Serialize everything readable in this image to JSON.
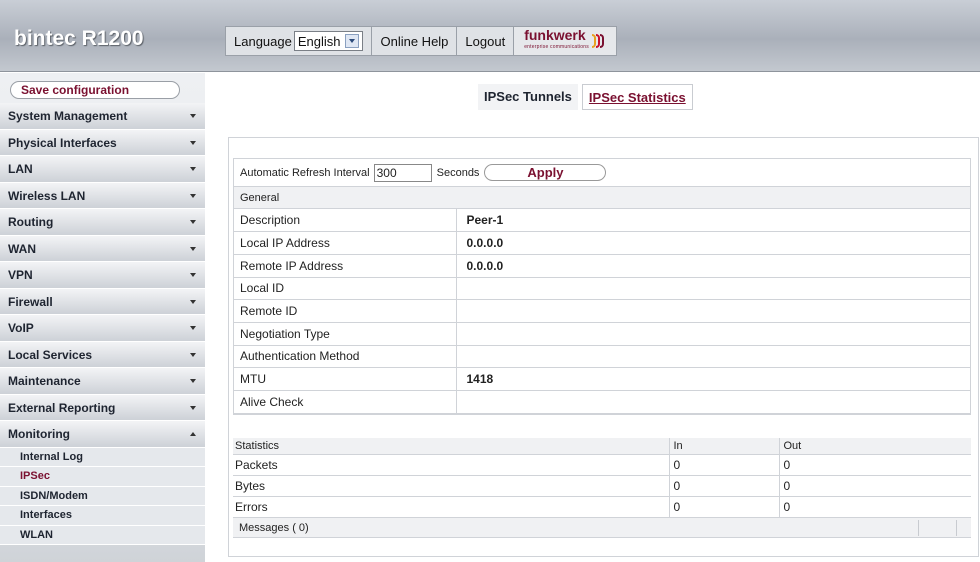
{
  "header": {
    "brand": "bintec R1200",
    "language_label": "Language",
    "language_value": "English",
    "online_help": "Online Help",
    "logout": "Logout",
    "logo_text": "funkwerk",
    "logo_sub": "enterprise communications",
    "logo_colors": [
      "#e8a020",
      "#c8102e",
      "#7a1030"
    ]
  },
  "sidebar": {
    "save_label": "Save configuration",
    "items": [
      {
        "label": "System Management"
      },
      {
        "label": "Physical Interfaces"
      },
      {
        "label": "LAN"
      },
      {
        "label": "Wireless LAN"
      },
      {
        "label": "Routing"
      },
      {
        "label": "WAN"
      },
      {
        "label": "VPN"
      },
      {
        "label": "Firewall"
      },
      {
        "label": "VoIP"
      },
      {
        "label": "Local Services"
      },
      {
        "label": "Maintenance"
      },
      {
        "label": "External Reporting"
      },
      {
        "label": "Monitoring"
      }
    ],
    "subitems": [
      {
        "label": "Internal Log"
      },
      {
        "label": "IPSec"
      },
      {
        "label": "ISDN/Modem"
      },
      {
        "label": "Interfaces"
      },
      {
        "label": "WLAN"
      }
    ]
  },
  "tabs": {
    "tunnels": "IPSec Tunnels",
    "statistics": "IPSec Statistics"
  },
  "refresh": {
    "label": "Automatic Refresh Interval",
    "value": "300",
    "unit": "Seconds",
    "apply": "Apply"
  },
  "general": {
    "header": "General",
    "rows": [
      {
        "key": "Description",
        "value": "Peer-1"
      },
      {
        "key": "Local IP Address",
        "value": "0.0.0.0"
      },
      {
        "key": "Remote IP Address",
        "value": "0.0.0.0"
      },
      {
        "key": "Local ID",
        "value": ""
      },
      {
        "key": "Remote ID",
        "value": ""
      },
      {
        "key": "Negotiation Type",
        "value": ""
      },
      {
        "key": "Authentication Method",
        "value": ""
      },
      {
        "key": "MTU",
        "value": "1418"
      },
      {
        "key": "Alive Check",
        "value": ""
      }
    ]
  },
  "stats": {
    "header": "Statistics",
    "col_in": "In",
    "col_out": "Out",
    "rows": [
      {
        "label": "Packets",
        "in": "0",
        "out": "0"
      },
      {
        "label": "Bytes",
        "in": "0",
        "out": "0"
      },
      {
        "label": "Errors",
        "in": "0",
        "out": "0"
      }
    ]
  },
  "messages": {
    "label": "Messages",
    "count": "( 0)"
  }
}
